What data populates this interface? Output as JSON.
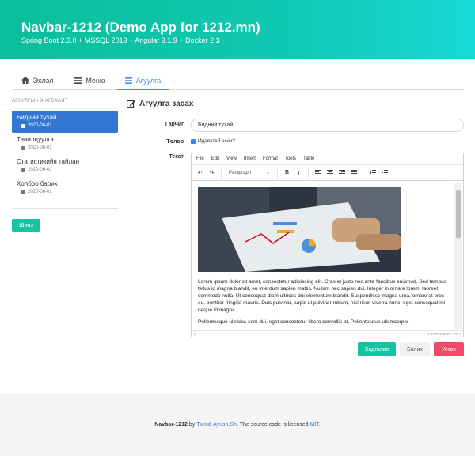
{
  "header": {
    "title": "Navbar-1212 (Demo App for 1212.mn)",
    "subtitle": "Spring Boot 2.3.0 + MSSQL 2019 + Angular 9.1.9 + Docker 2.3"
  },
  "tabs": [
    {
      "label": "Эхлэл",
      "icon": "home-icon"
    },
    {
      "label": "Меню",
      "icon": "menu-icon"
    },
    {
      "label": "Агуулга",
      "icon": "list-icon",
      "active": true
    }
  ],
  "sidebar": {
    "title": "АГУУЛГЫН ЖАГСААЛТ",
    "items": [
      {
        "title": "Бидний тухай",
        "date": "2020-06-01",
        "active": true
      },
      {
        "title": "Танилцуулга",
        "date": "2020-06-01"
      },
      {
        "title": "Статистикийн тайлан",
        "date": "2020-06-01"
      },
      {
        "title": "Холбоо барих",
        "date": "2020-06-01"
      }
    ],
    "new_button": "Шинэ"
  },
  "form": {
    "title": "Агуулга засах",
    "title_label": "Гарчиг",
    "title_value": "Бидний тухай",
    "status_label": "Төлөв",
    "status_checkbox_label": "Идэвхтэй эсэх?",
    "text_label": "Текст",
    "editor": {
      "menu": [
        "File",
        "Edit",
        "View",
        "Insert",
        "Format",
        "Tools",
        "Table"
      ],
      "format_select": "Paragraph",
      "para1": "Lorem ipsum dolor sit amet, consectetur adipiscing elit. Cras et justo nec ante faucibus euismod. Sed tempus tellus id magna blandit, eu interdum sapien mattis. Nullam nec sapien dui. Integer in ornare lorem, laoreet commodo nulla. Ut consequat diam ultrices dui elementum blandit. Suspendisse magna urna, ornare ut eros eu, porttitor fringilla mauris. Duis pulvinar, turpis ut pulvinar rutrum, nisl risus viverra nunc, eget consequat mi neque id magna.",
      "para2": "Pellentesque ultricies sem dui, eget consectetur libero convallis at. Pellentesque ullamcorper",
      "status_left": "p",
      "status_right": "POWERED BY TINY"
    },
    "save_button": "Хадгалах",
    "cancel_button": "Болих",
    "delete_button": "Устах"
  },
  "footer": {
    "brand": "Navbar-1212",
    "by": " by ",
    "author": "Tsend-Ayush.Sh",
    "license_text": ". The source code is licensed ",
    "license": "MIT",
    "end": "."
  },
  "colors": {
    "primary": "#18c3a2",
    "accent": "#3477d2",
    "danger": "#ef4b69"
  }
}
